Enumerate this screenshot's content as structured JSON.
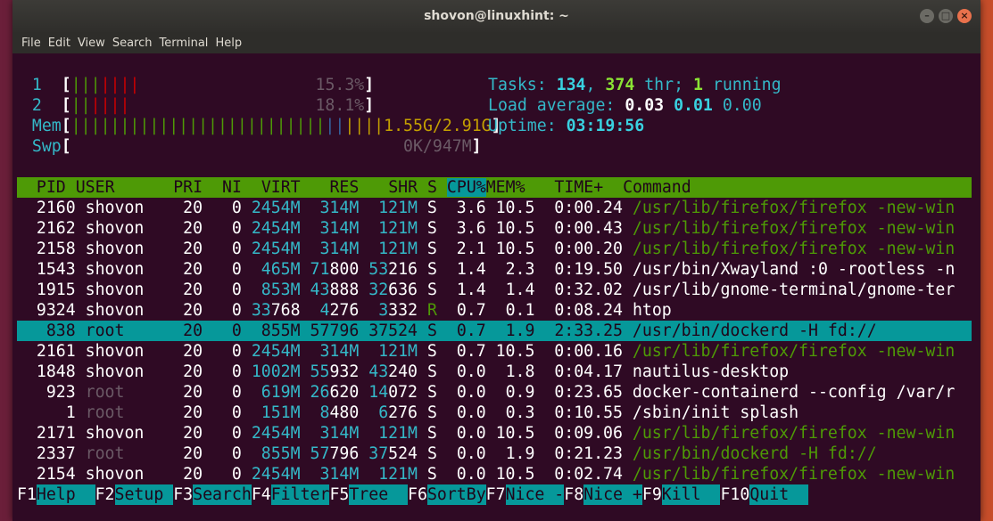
{
  "window": {
    "title": "shovon@linuxhint: ~",
    "buttons": [
      "–",
      "□",
      "×"
    ]
  },
  "menu": [
    "File",
    "Edit",
    "View",
    "Search",
    "Terminal",
    "Help"
  ],
  "meters": {
    "cpu1": {
      "label": "1",
      "bars_green": "|||",
      "bars_red": "||||",
      "percent": "15.3%"
    },
    "cpu2": {
      "label": "2",
      "bars_green": "||",
      "bars_red": "||||",
      "percent": "18.1%"
    },
    "mem": {
      "label": "Mem",
      "bars_green": "||||||||||||||||||||||||||",
      "bars_blue": "||",
      "bars_yellow": "||||",
      "value": "1.55G/2.91G"
    },
    "swp": {
      "label": "Swp",
      "value": "0K/947M"
    }
  },
  "summary": {
    "tasks_label": "Tasks: ",
    "tasks": "134",
    "thr": "374",
    "thr_label": " thr; ",
    "running": "1",
    "running_label": " running",
    "load_label": "Load average: ",
    "load1": "0.03",
    "load5": "0.01",
    "load15": "0.00",
    "uptime_label": "Uptime: ",
    "uptime": "03:19:56"
  },
  "table": {
    "headers": [
      "PID",
      "USER",
      "PRI",
      "NI",
      "VIRT",
      "RES",
      "SHR",
      "S",
      "CPU%",
      "MEM%",
      "TIME+",
      "Command"
    ],
    "rows": [
      {
        "pid": "2160",
        "user": "shovon",
        "pri": "20",
        "ni": "0",
        "virt": "2454M",
        "res": "314M",
        "shr": "121M",
        "s": "S",
        "cpu": "3.6",
        "mem": "10.5",
        "time": "0:00.24",
        "cmd": "/usr/lib/firefox/firefox -new-win"
      },
      {
        "pid": "2162",
        "user": "shovon",
        "pri": "20",
        "ni": "0",
        "virt": "2454M",
        "res": "314M",
        "shr": "121M",
        "s": "S",
        "cpu": "3.6",
        "mem": "10.5",
        "time": "0:00.43",
        "cmd": "/usr/lib/firefox/firefox -new-win"
      },
      {
        "pid": "2158",
        "user": "shovon",
        "pri": "20",
        "ni": "0",
        "virt": "2454M",
        "res": "314M",
        "shr": "121M",
        "s": "S",
        "cpu": "2.1",
        "mem": "10.5",
        "time": "0:00.20",
        "cmd": "/usr/lib/firefox/firefox -new-win"
      },
      {
        "pid": "1543",
        "user": "shovon",
        "pri": "20",
        "ni": "0",
        "virt": "465M",
        "res": "71800",
        "shr": "53216",
        "s": "S",
        "cpu": "1.4",
        "mem": "2.3",
        "time": "0:19.50",
        "cmd": "/usr/bin/Xwayland :0 -rootless -n"
      },
      {
        "pid": "1915",
        "user": "shovon",
        "pri": "20",
        "ni": "0",
        "virt": "853M",
        "res": "43888",
        "shr": "32636",
        "s": "S",
        "cpu": "1.4",
        "mem": "1.4",
        "time": "0:32.02",
        "cmd": "/usr/lib/gnome-terminal/gnome-ter"
      },
      {
        "pid": "9324",
        "user": "shovon",
        "pri": "20",
        "ni": "0",
        "virt": "33768",
        "res": "4276",
        "shr": "3332",
        "s": "R",
        "cpu": "0.7",
        "mem": "0.1",
        "time": "0:08.24",
        "cmd": "htop"
      },
      {
        "pid": "838",
        "user": "root",
        "pri": "20",
        "ni": "0",
        "virt": "855M",
        "res": "57796",
        "shr": "37524",
        "s": "S",
        "cpu": "0.7",
        "mem": "1.9",
        "time": "2:33.25",
        "cmd": "/usr/bin/dockerd -H fd://"
      },
      {
        "pid": "2161",
        "user": "shovon",
        "pri": "20",
        "ni": "0",
        "virt": "2454M",
        "res": "314M",
        "shr": "121M",
        "s": "S",
        "cpu": "0.7",
        "mem": "10.5",
        "time": "0:00.16",
        "cmd": "/usr/lib/firefox/firefox -new-win"
      },
      {
        "pid": "1848",
        "user": "shovon",
        "pri": "20",
        "ni": "0",
        "virt": "1002M",
        "res": "55932",
        "shr": "43240",
        "s": "S",
        "cpu": "0.0",
        "mem": "1.8",
        "time": "0:04.17",
        "cmd": "nautilus-desktop"
      },
      {
        "pid": "923",
        "user": "root",
        "pri": "20",
        "ni": "0",
        "virt": "619M",
        "res": "26620",
        "shr": "14072",
        "s": "S",
        "cpu": "0.0",
        "mem": "0.9",
        "time": "0:23.65",
        "cmd": "docker-containerd --config /var/r"
      },
      {
        "pid": "1",
        "user": "root",
        "pri": "20",
        "ni": "0",
        "virt": "151M",
        "res": "8480",
        "shr": "6276",
        "s": "S",
        "cpu": "0.0",
        "mem": "0.3",
        "time": "0:10.55",
        "cmd": "/sbin/init splash"
      },
      {
        "pid": "2171",
        "user": "shovon",
        "pri": "20",
        "ni": "0",
        "virt": "2454M",
        "res": "314M",
        "shr": "121M",
        "s": "S",
        "cpu": "0.0",
        "mem": "10.5",
        "time": "0:09.06",
        "cmd": "/usr/lib/firefox/firefox -new-win"
      },
      {
        "pid": "2337",
        "user": "root",
        "pri": "20",
        "ni": "0",
        "virt": "855M",
        "res": "57796",
        "shr": "37524",
        "s": "S",
        "cpu": "0.0",
        "mem": "1.9",
        "time": "0:21.23",
        "cmd": "/usr/bin/dockerd -H fd://"
      },
      {
        "pid": "2154",
        "user": "shovon",
        "pri": "20",
        "ni": "0",
        "virt": "2454M",
        "res": "314M",
        "shr": "121M",
        "s": "S",
        "cpu": "0.0",
        "mem": "10.5",
        "time": "0:02.74",
        "cmd": "/usr/lib/firefox/firefox -new-win"
      }
    ],
    "selected_pid": "838"
  },
  "fkeys": [
    {
      "key": "F1",
      "label": "Help  "
    },
    {
      "key": "F2",
      "label": "Setup "
    },
    {
      "key": "F3",
      "label": "Search"
    },
    {
      "key": "F4",
      "label": "Filter"
    },
    {
      "key": "F5",
      "label": "Tree  "
    },
    {
      "key": "F6",
      "label": "SortBy"
    },
    {
      "key": "F7",
      "label": "Nice -"
    },
    {
      "key": "F8",
      "label": "Nice +"
    },
    {
      "key": "F9",
      "label": "Kill  "
    },
    {
      "key": "F10",
      "label": "Quit  "
    }
  ],
  "colors": {
    "terminal_bg": "#2f0a24",
    "header_bg": "#4e9a06",
    "selection_bg": "#06989a"
  }
}
